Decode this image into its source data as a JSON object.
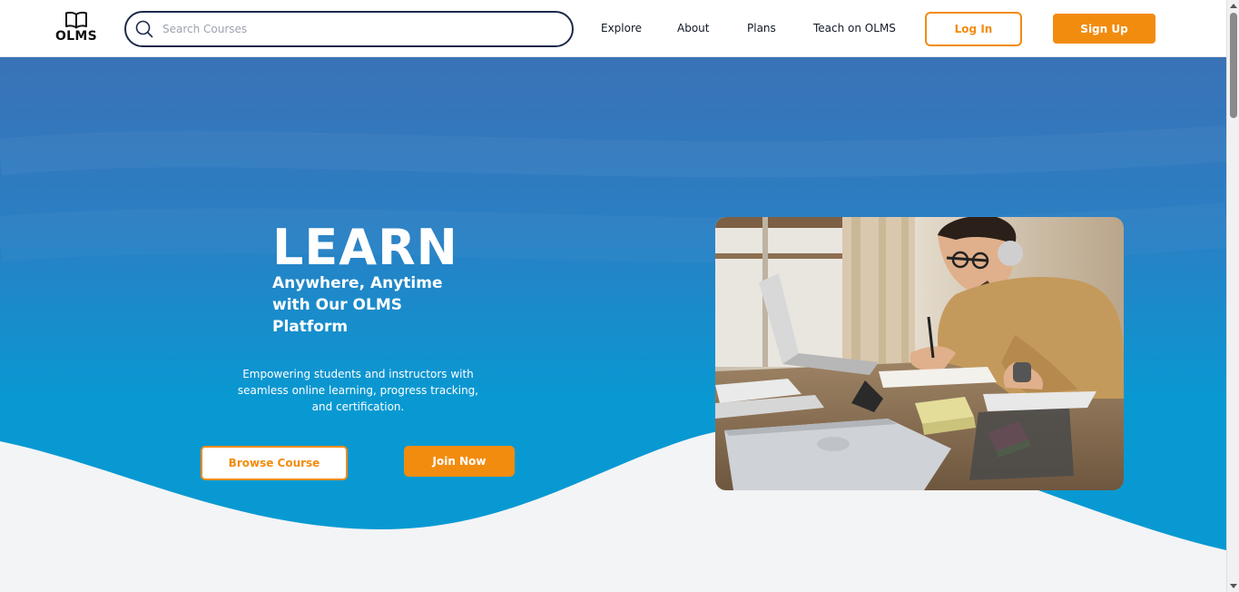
{
  "header": {
    "logo_text": "OLMS",
    "search": {
      "placeholder": "Search Courses",
      "value": ""
    },
    "nav": [
      {
        "label": "Explore"
      },
      {
        "label": "About"
      },
      {
        "label": "Plans"
      },
      {
        "label": "Teach on OLMS"
      }
    ],
    "login_label": "Log In",
    "signup_label": "Sign Up"
  },
  "hero": {
    "title": "LEARN",
    "subtitle": "Anywhere, Anytime with Our OLMS Platform",
    "description": "Empowering students and instructors with seamless online learning, progress tracking, and certification.",
    "browse_label": "Browse Course",
    "join_label": "Join Now"
  },
  "theme": {
    "accent": "#f28c0f",
    "hero_blue_top": "#3a72b6",
    "hero_blue_bottom": "#0899d2",
    "background": "#f3f4f6",
    "search_border": "#1e2a4a"
  },
  "icons": {
    "logo": "open-book-icon",
    "search": "search-icon"
  }
}
